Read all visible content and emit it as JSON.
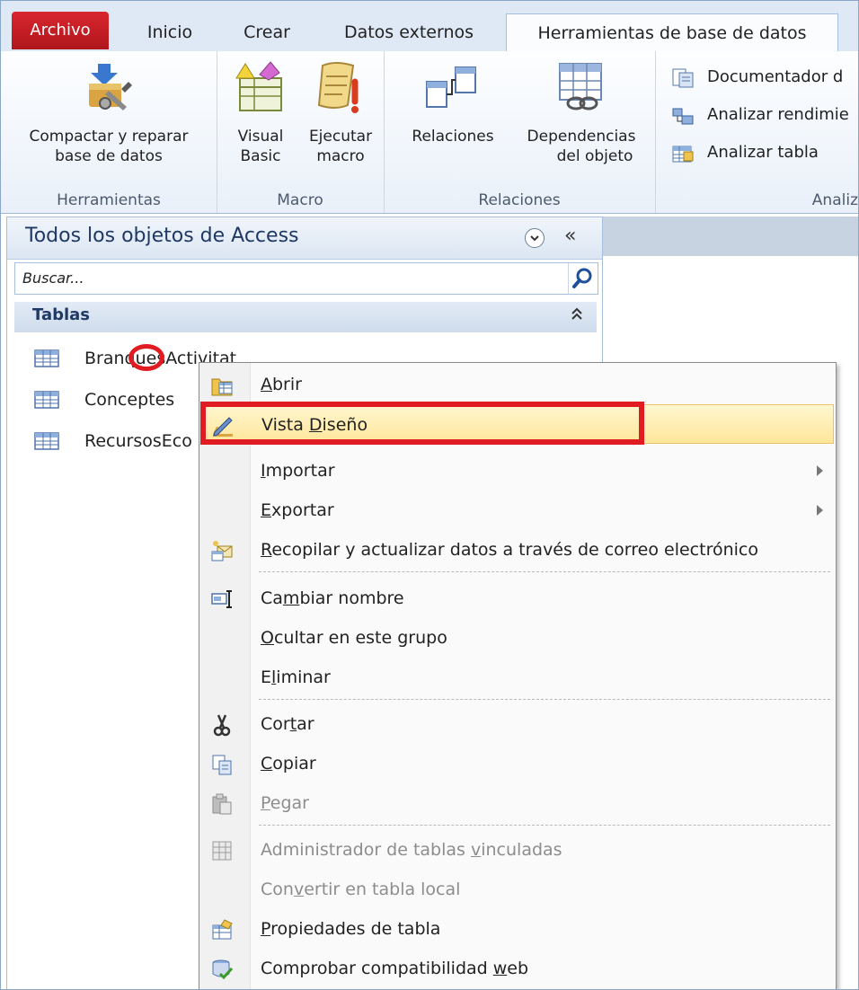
{
  "tabs": [
    {
      "label": "Archivo"
    },
    {
      "label": "Inicio"
    },
    {
      "label": "Crear"
    },
    {
      "label": "Datos externos"
    },
    {
      "label": "Herramientas de base de datos"
    }
  ],
  "ribbon": {
    "groups": [
      {
        "label": "Herramientas"
      },
      {
        "label": "Macro"
      },
      {
        "label": "Relaciones"
      },
      {
        "label": "Analiz"
      }
    ],
    "compact": {
      "line1": "Compactar y reparar",
      "line2": "base de datos"
    },
    "visual_basic": {
      "line1": "Visual",
      "line2": "Basic"
    },
    "run_macro": {
      "line1": "Ejecutar",
      "line2": "macro"
    },
    "relations": {
      "line1": "Relaciones"
    },
    "dependencies": {
      "line1": "Dependencias",
      "line2": "del objeto"
    },
    "documenter": "Documentador d",
    "perf": "Analizar rendimie",
    "table_analyzer": "Analizar tabla"
  },
  "nav": {
    "title": "Todos los objetos de Access",
    "collapse": "«",
    "search_placeholder": "Buscar...",
    "section": "Tablas",
    "section_chevron": "⌃",
    "items": [
      {
        "label": "BranquesActivitat"
      },
      {
        "label": "Conceptes"
      },
      {
        "label": "RecursosEco"
      }
    ]
  },
  "menu": {
    "items": [
      {
        "pre": "",
        "key": "A",
        "post": "brir"
      },
      {
        "pre": "Vista ",
        "key": "D",
        "post": "iseño"
      },
      {
        "pre": "",
        "key": "I",
        "post": "mportar"
      },
      {
        "pre": "",
        "key": "E",
        "post": "xportar"
      },
      {
        "pre": "",
        "key": "R",
        "post": "ecopilar y actualizar datos a través de correo electrónico"
      },
      {
        "pre": "Ca",
        "key": "m",
        "post": "biar nombre"
      },
      {
        "pre": "",
        "key": "O",
        "post": "cultar en este grupo"
      },
      {
        "pre": "E",
        "key": "l",
        "post": "iminar"
      },
      {
        "pre": "Cor",
        "key": "t",
        "post": "ar"
      },
      {
        "pre": "",
        "key": "C",
        "post": "opiar"
      },
      {
        "pre": "",
        "key": "P",
        "post": "egar"
      },
      {
        "pre": "Administrador de tablas ",
        "key": "v",
        "post": "inculadas"
      },
      {
        "pre": "Con",
        "key": "v",
        "post": "ertir en tabla local"
      },
      {
        "pre": "",
        "key": "P",
        "post": "ropiedades de tabla"
      },
      {
        "pre": "Comprobar compatibilidad ",
        "key": "w",
        "post": "eb"
      }
    ]
  },
  "colors": {
    "file_tab": "#c41e25",
    "highlight": "#ffe69a",
    "annotation_red": "#e11b22"
  }
}
